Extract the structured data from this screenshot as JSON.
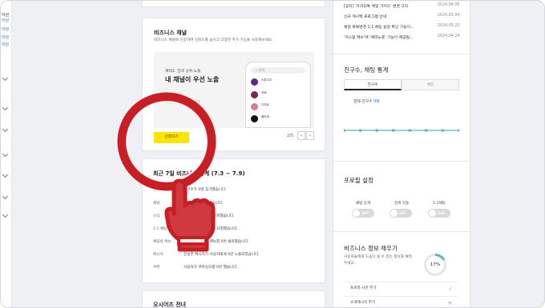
{
  "sidebar": {
    "texts": [
      {
        "label": "이원",
        "blue": false
      },
      {
        "label": "이원",
        "blue": true
      },
      {
        "label": "이원",
        "blue": true
      },
      {
        "label": "이원",
        "blue": true
      },
      {
        "label": "이원",
        "blue": true
      }
    ]
  },
  "business_channel": {
    "title": "비즈니스 채널",
    "subtitle": "비즈니스 채널로 인증하여 신뢰도를 높이고 다양한 추가 기능을 사용해보세요.",
    "promo": {
      "benefit": "혜택2. 검색 상위 노출",
      "headline": "내 채널이 우선 노출",
      "line1": "...",
      "line2": "...",
      "line3": "우선적으로 노출됩니다."
    },
    "phone": {
      "search": "검색",
      "rows": [
        {
          "name": "스튜디오",
          "desc": "..."
        },
        {
          "name": "카페",
          "desc": "..."
        },
        {
          "name": "디저트",
          "desc": "..."
        },
        {
          "name": "플라워",
          "desc": "..."
        }
      ]
    },
    "apply_button": "신청하기",
    "pager": "2/5",
    "pager_prev": "‹",
    "pager_next": "›"
  },
  "stats": {
    "title": "최근 7일 비즈니스 통계 (7.3 ~ 7.9)",
    "rows": [
      {
        "label": "친구",
        "text": "친구수가 0명 증가했습니다."
      },
      {
        "label": "채널",
        "text": "채널을 0회 조회했습니다."
      },
      {
        "label": "소식",
        "text": "발행한 소식을 0번 조회했습니다."
      },
      {
        "label": "1:1 채팅",
        "text": "사용자가 1:1 채팅을 요청했습니다."
      },
      {
        "label": "채팅방 메뉴",
        "text": "사용자가 채팅방 메뉴를 0번 클릭했습니다."
      },
      {
        "label": "메시지",
        "text": "전송한 메시지가 사용자에게 0번 노출되었습니다."
      },
      {
        "label": "쿠폰",
        "text": "사용자가 쿠폰응모를 0번 했습니다."
      }
    ]
  },
  "next_card_title": "오시어즈 전녀",
  "notices": [
    {
      "title": "[공지] '카카오톡 채널 가이드' 변경 고지",
      "date": "2024.06.05"
    },
    {
      "title": "신규 캐시백 프로그램 안내",
      "date": "2024.05.04"
    },
    {
      "title": "채널 목록변경 1:1 채팅 응원 확인 기능이...",
      "date": "2024.05.20"
    },
    {
      "title": "'커스텀 메뉴'에 '예약노출' 기능이 제공됩...",
      "date": "2024.04.24"
    }
  ],
  "friends_chat": {
    "title": "친구수, 채팅 통계",
    "tabs": [
      "친구수",
      "채팅"
    ],
    "current_label": "현재 친구수",
    "current_value": "0명",
    "points": [
      0,
      0,
      0,
      0,
      0,
      0,
      0,
      0
    ]
  },
  "profile_settings": {
    "title": "프로필 설정",
    "toggles": [
      {
        "label": "채널 공개",
        "state": "OFF"
      },
      {
        "label": "검색 허용",
        "state": "OFF"
      },
      {
        "label": "1:1채팅",
        "state": "OFF"
      }
    ]
  },
  "biz_info": {
    "title": "비즈니스 정보 채우기",
    "desc1": "사용자들에게 도움이 될 수 있는 정보를 채워",
    "desc2": "주세요.",
    "progress_label": "17%",
    "progress_value": 0.17,
    "items": [
      {
        "label": "프로필 사진 추가",
        "done": true
      },
      {
        "label": "소개메시지 추가",
        "done": false
      }
    ]
  }
}
